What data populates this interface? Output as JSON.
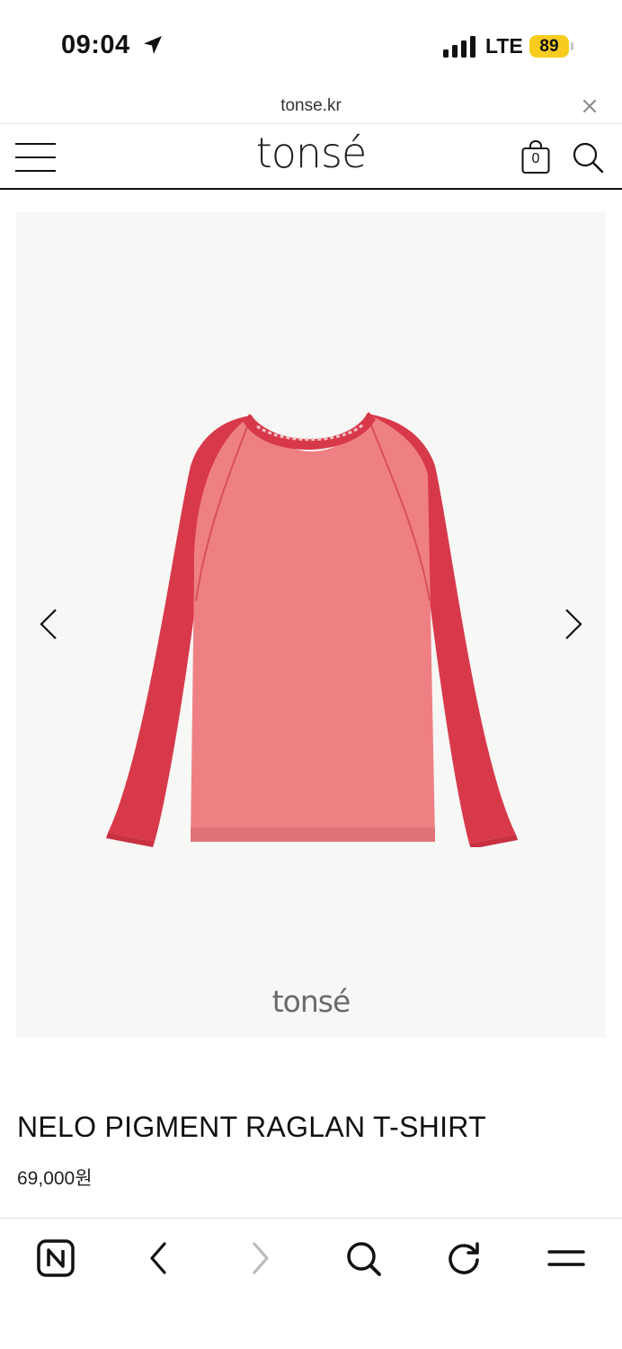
{
  "status_bar": {
    "time": "09:04",
    "network": "LTE",
    "battery": "89",
    "battery_color": "#f7cc1e"
  },
  "url_bar": {
    "domain": "tonse.kr",
    "close_icon": "close-icon"
  },
  "header": {
    "logo": "tonsé",
    "cart_count": "0",
    "icons": [
      "menu-icon",
      "cart-icon",
      "search-icon"
    ]
  },
  "product": {
    "image_watermark": "tonsé",
    "title": "NELO PIGMENT RAGLAN T-SHIRT",
    "price": "69,000원",
    "colors": {
      "body": "#ec7d80",
      "sleeves": "#d8394a"
    }
  },
  "toolbar": {
    "icons": [
      "naver-home-icon",
      "back-icon",
      "forward-icon",
      "search-icon",
      "reload-icon",
      "menu-icon"
    ]
  }
}
